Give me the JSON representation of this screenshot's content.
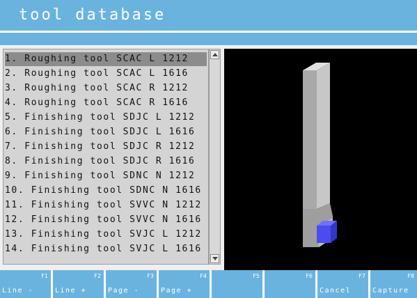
{
  "window": {
    "title": "tool database"
  },
  "tool_list": {
    "selected_index": 0,
    "items": [
      "1. Roughing tool SCAC L 1212",
      "2. Roughing tool SCAC L 1616",
      "3. Roughing tool SCAC R 1212",
      "4. Roughing tool SCAC R 1616",
      "5. Finishing tool SDJC L 1212",
      "6. Finishing tool SDJC L 1616",
      "7. Finishing tool SDJC R 1212",
      "8. Finishing tool SDJC R 1616",
      "9. Finishing tool SDNC N 1212",
      "10. Finishing tool SDNC N 1616",
      "11. Finishing tool SVVC N 1212",
      "12. Finishing tool SVVC N 1616",
      "13. Finishing tool SVJC L 1212",
      "14. Finishing tool SVJC L 1616"
    ]
  },
  "softkeys": [
    {
      "key": "F1",
      "label": "Line -"
    },
    {
      "key": "F2",
      "label": "Line +"
    },
    {
      "key": "F3",
      "label": "Page -"
    },
    {
      "key": "F4",
      "label": "Page +"
    },
    {
      "key": "F5",
      "label": ""
    },
    {
      "key": "F6",
      "label": ""
    },
    {
      "key": "F7",
      "label": "Cancel"
    },
    {
      "key": "F8",
      "label": "Capture"
    }
  ],
  "colors": {
    "accent": "#6ab3df",
    "tool_insert": "#4a4cf0",
    "tool_body": "#c4c4c4"
  }
}
